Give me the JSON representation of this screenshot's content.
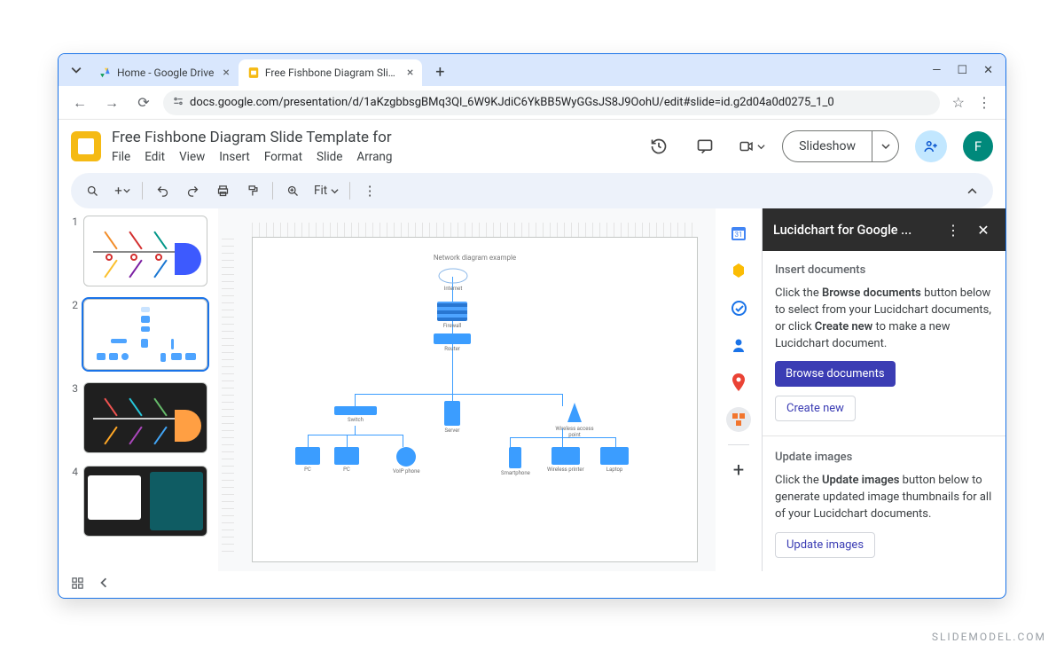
{
  "browser": {
    "tabs": [
      {
        "title": "Home - Google Drive",
        "favicon": "drive"
      },
      {
        "title": "Free Fishbone Diagram Slide Te",
        "favicon": "slides"
      }
    ],
    "url": "docs.google.com/presentation/d/1aKzgbbsgBMq3Ql_6W9KJdiC6YkBB5WyGGsJS8J9OohU/edit#slide=id.g2d04a0d0275_1_0"
  },
  "doc": {
    "title": "Free Fishbone Diagram Slide Template for",
    "menus": [
      "File",
      "Edit",
      "View",
      "Insert",
      "Format",
      "Slide",
      "Arrang"
    ]
  },
  "header": {
    "slideshow": "Slideshow",
    "avatar_initial": "F"
  },
  "toolbar": {
    "zoom_label": "Fit"
  },
  "slides": {
    "numbers": [
      "1",
      "2",
      "3",
      "4"
    ],
    "canvas_title": "Network diagram example",
    "nodes": {
      "internet": "Internet",
      "firewall": "Firewall",
      "router": "Router",
      "switch": "Switch",
      "server": "Server",
      "wap": "Wireless access point",
      "pc1": "PC",
      "pc2": "PC",
      "voip": "VoIP phone",
      "smartphone": "Smartphone",
      "printer": "Wireless printer",
      "laptop": "Laptop"
    }
  },
  "lucid": {
    "panel_title": "Lucidchart for Google ...",
    "insert_title": "Insert documents",
    "insert_text_pre": "Click the ",
    "insert_bold1": "Browse documents",
    "insert_text_mid": " button below to select from your Lucidchart documents, or click ",
    "insert_bold2": "Create new",
    "insert_text_post": " to make a new Lucidchart document.",
    "browse_btn": "Browse documents",
    "create_btn": "Create new",
    "update_title": "Update images",
    "update_text_pre": "Click the ",
    "update_bold": "Update images",
    "update_text_post": " button below to generate updated image thumbnails for all of your Lucidchart documents.",
    "update_btn": "Update images"
  },
  "watermark": "SLIDEMODEL.COM"
}
